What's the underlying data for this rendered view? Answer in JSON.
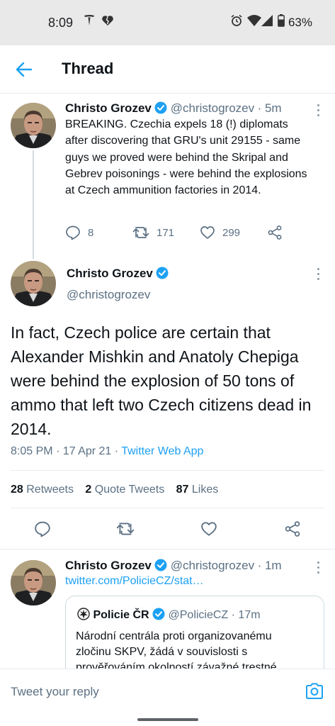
{
  "status_bar": {
    "time": "8:09",
    "battery": "63%",
    "left_icons": [
      "tesla-icon",
      "heart-broken-icon"
    ],
    "right_icons": [
      "alarm-icon",
      "wifi-icon",
      "signal-icon",
      "battery-icon"
    ]
  },
  "header": {
    "title": "Thread"
  },
  "tweet1": {
    "name": "Christo Grozev",
    "handle": "@christogrozev",
    "time": "· 5m",
    "text": "BREAKING. Czechia expels 18 (!) diplomats after discovering that GRU's unit 29155 - same guys we proved were behind the Skripal and Gebrev poisonings - were behind the explosions at Czech ammunition factories in 2014.",
    "replies": "8",
    "retweets": "171",
    "likes": "299"
  },
  "tweet2": {
    "name": "Christo Grozev",
    "handle": "@christogrozev",
    "text": "In fact, Czech police are certain that Alexander Mishkin and Anatoly Chepiga were behind the explosion of 50 tons of ammo that left two Czech citizens dead in 2014.",
    "timestamp": "8:05 PM · 17 Apr 21 · ",
    "source": "Twitter Web App",
    "retweets_count": "28",
    "retweets_label": "Retweets",
    "quotes_count": "2",
    "quotes_label": "Quote Tweets",
    "likes_count": "87",
    "likes_label": "Likes"
  },
  "tweet3": {
    "name": "Christo Grozev",
    "handle": "@christogrozev",
    "time": "· 1m",
    "link": "twitter.com/PolicieCZ/stat…",
    "quote": {
      "name": "Policie ČR",
      "handle": "@PolicieCZ",
      "time": "· 17m",
      "text": "Národní centrála proti organizovanému zločinu SKPV, žádá v souvislosti s prověřováním okolností závažné trestné"
    }
  },
  "reply": {
    "placeholder": "Tweet your reply"
  },
  "colors": {
    "accent": "#1da1f2",
    "text": "#0f1419",
    "secondary": "#5b7083",
    "divider": "#e6ecf0"
  }
}
